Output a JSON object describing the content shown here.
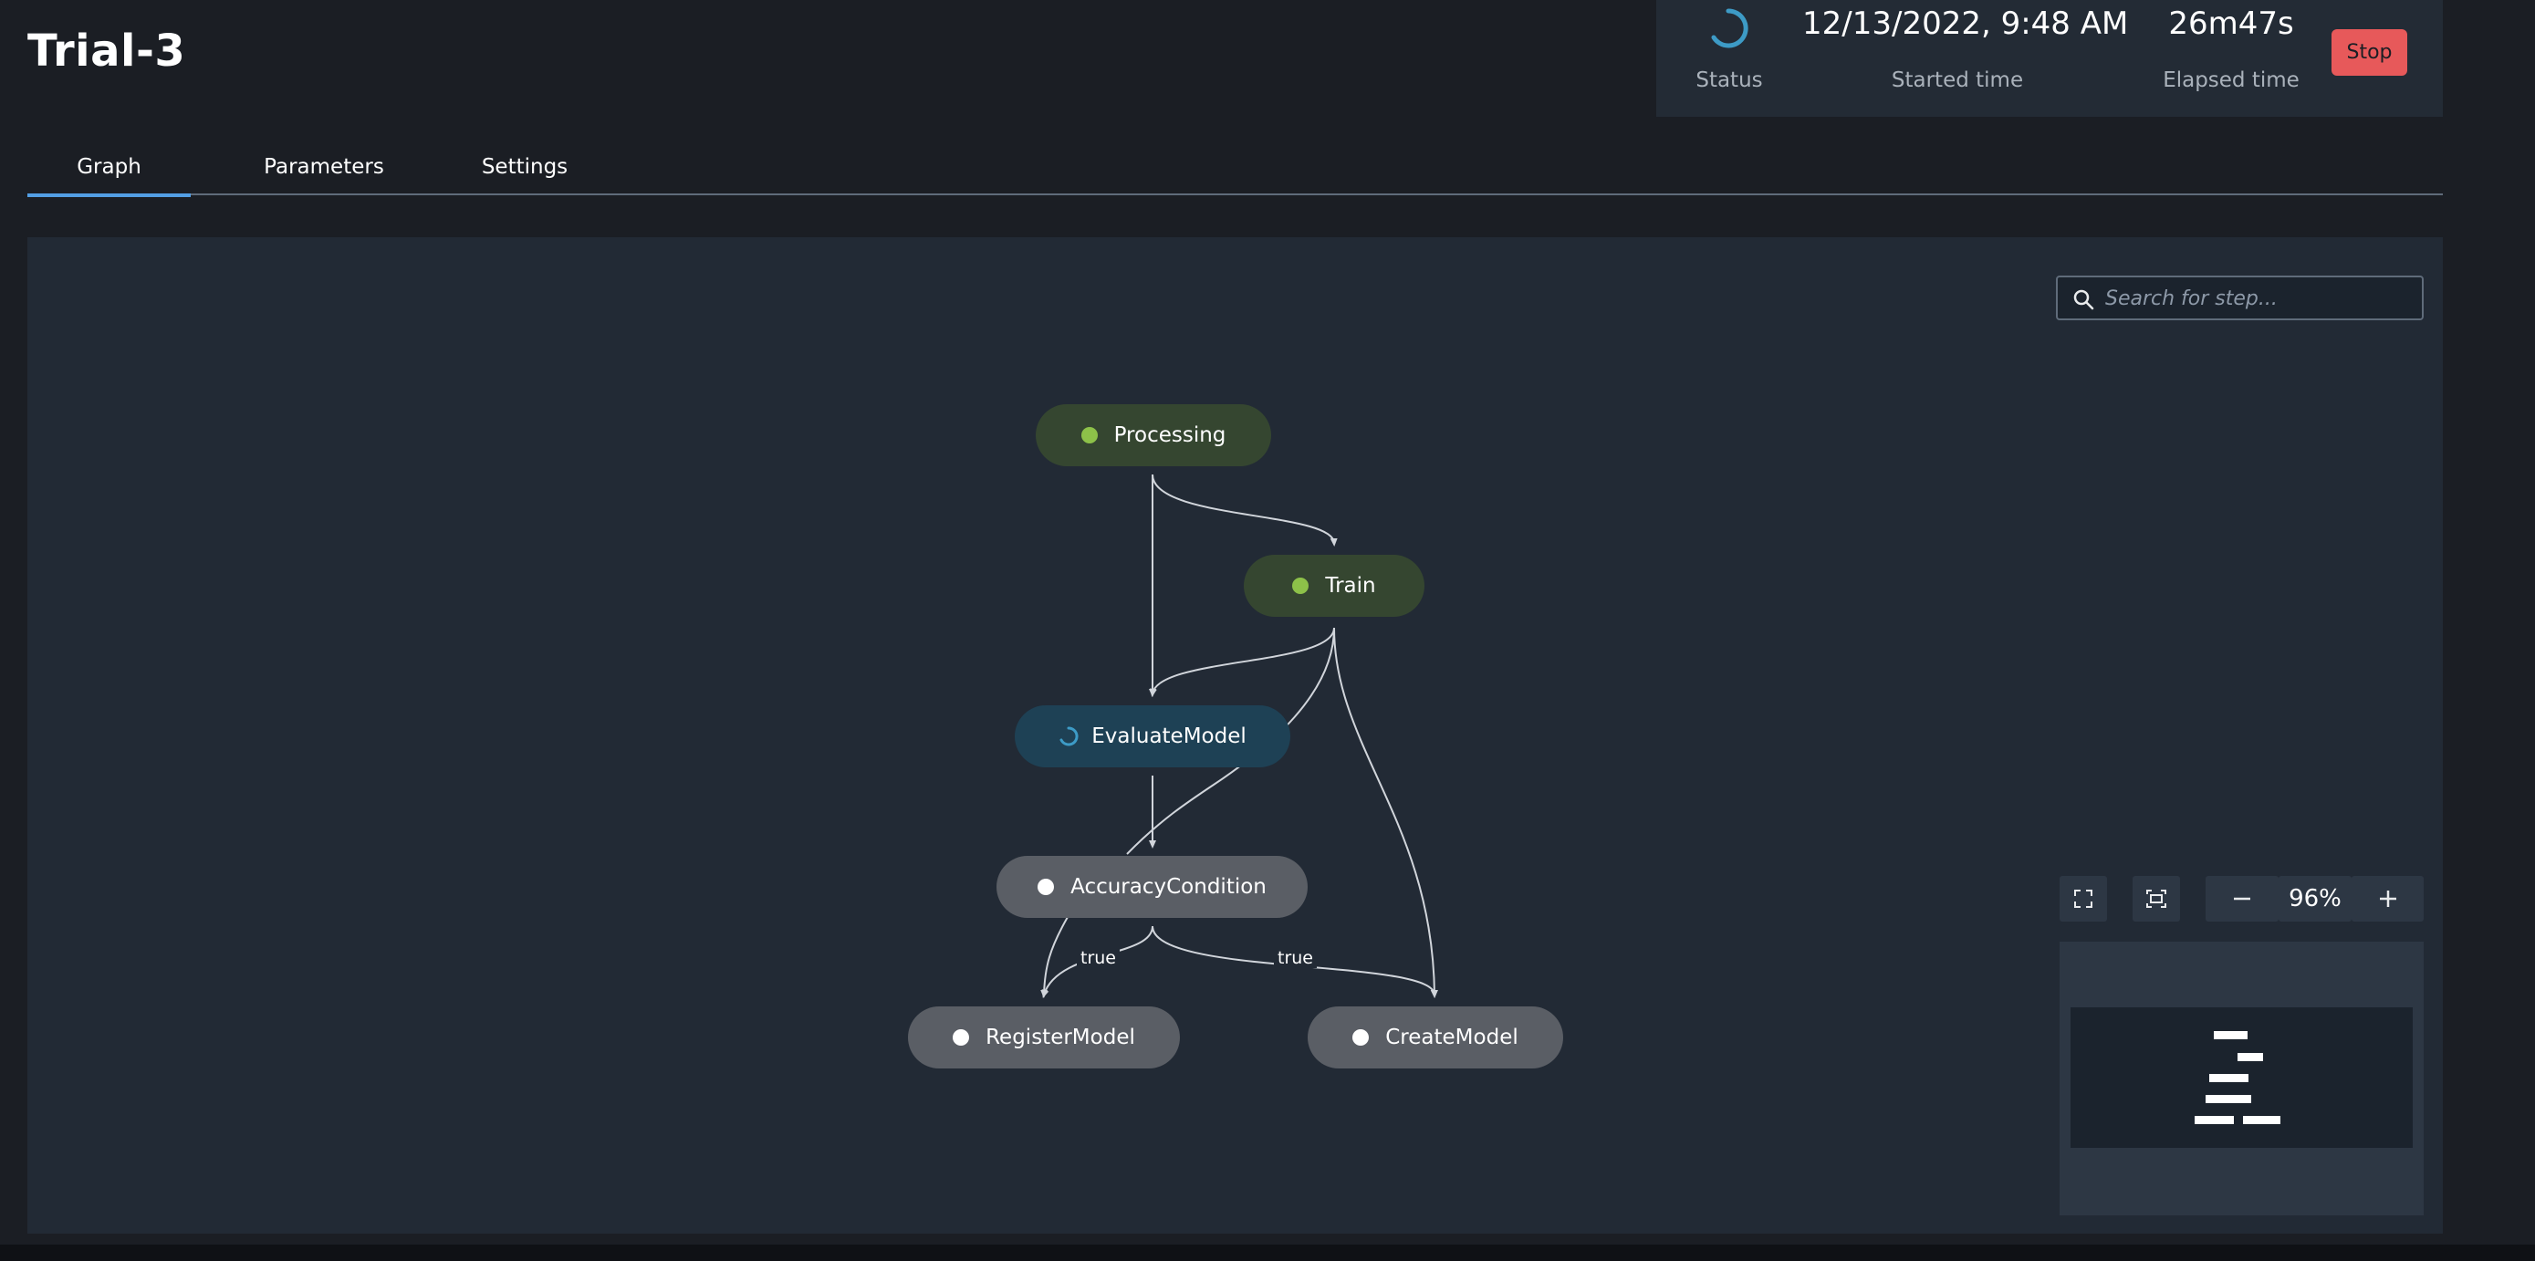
{
  "page": {
    "title": "Trial-3"
  },
  "status_panel": {
    "status_label": "Status",
    "started_time": "12/13/2022, 9:48 AM",
    "started_time_label": "Started time",
    "elapsed_time": "26m47s",
    "elapsed_time_label": "Elapsed time",
    "stop_label": "Stop"
  },
  "tabs": [
    {
      "label": "Graph",
      "active": true
    },
    {
      "label": "Parameters",
      "active": false
    },
    {
      "label": "Settings",
      "active": false
    }
  ],
  "graph": {
    "search_placeholder": "Search for step...",
    "nodes": [
      {
        "label": "Processing",
        "status": "succeeded"
      },
      {
        "label": "Train",
        "status": "succeeded"
      },
      {
        "label": "EvaluateModel",
        "status": "executing"
      },
      {
        "label": "AccuracyCondition",
        "status": "pending"
      },
      {
        "label": "RegisterModel",
        "status": "pending"
      },
      {
        "label": "CreateModel",
        "status": "pending"
      }
    ],
    "edge_labels": [
      "true",
      "true"
    ],
    "zoom_level": "96%"
  },
  "colors": {
    "accent": "#539fe5",
    "succeeded": "#8dc149",
    "stop": "#e7595a",
    "executing_spinner": "#3d9bc6"
  },
  "icons": [
    "spinner-icon",
    "search-icon",
    "fullscreen-icon",
    "fit-view-icon",
    "zoom-out-icon",
    "zoom-in-icon"
  ]
}
